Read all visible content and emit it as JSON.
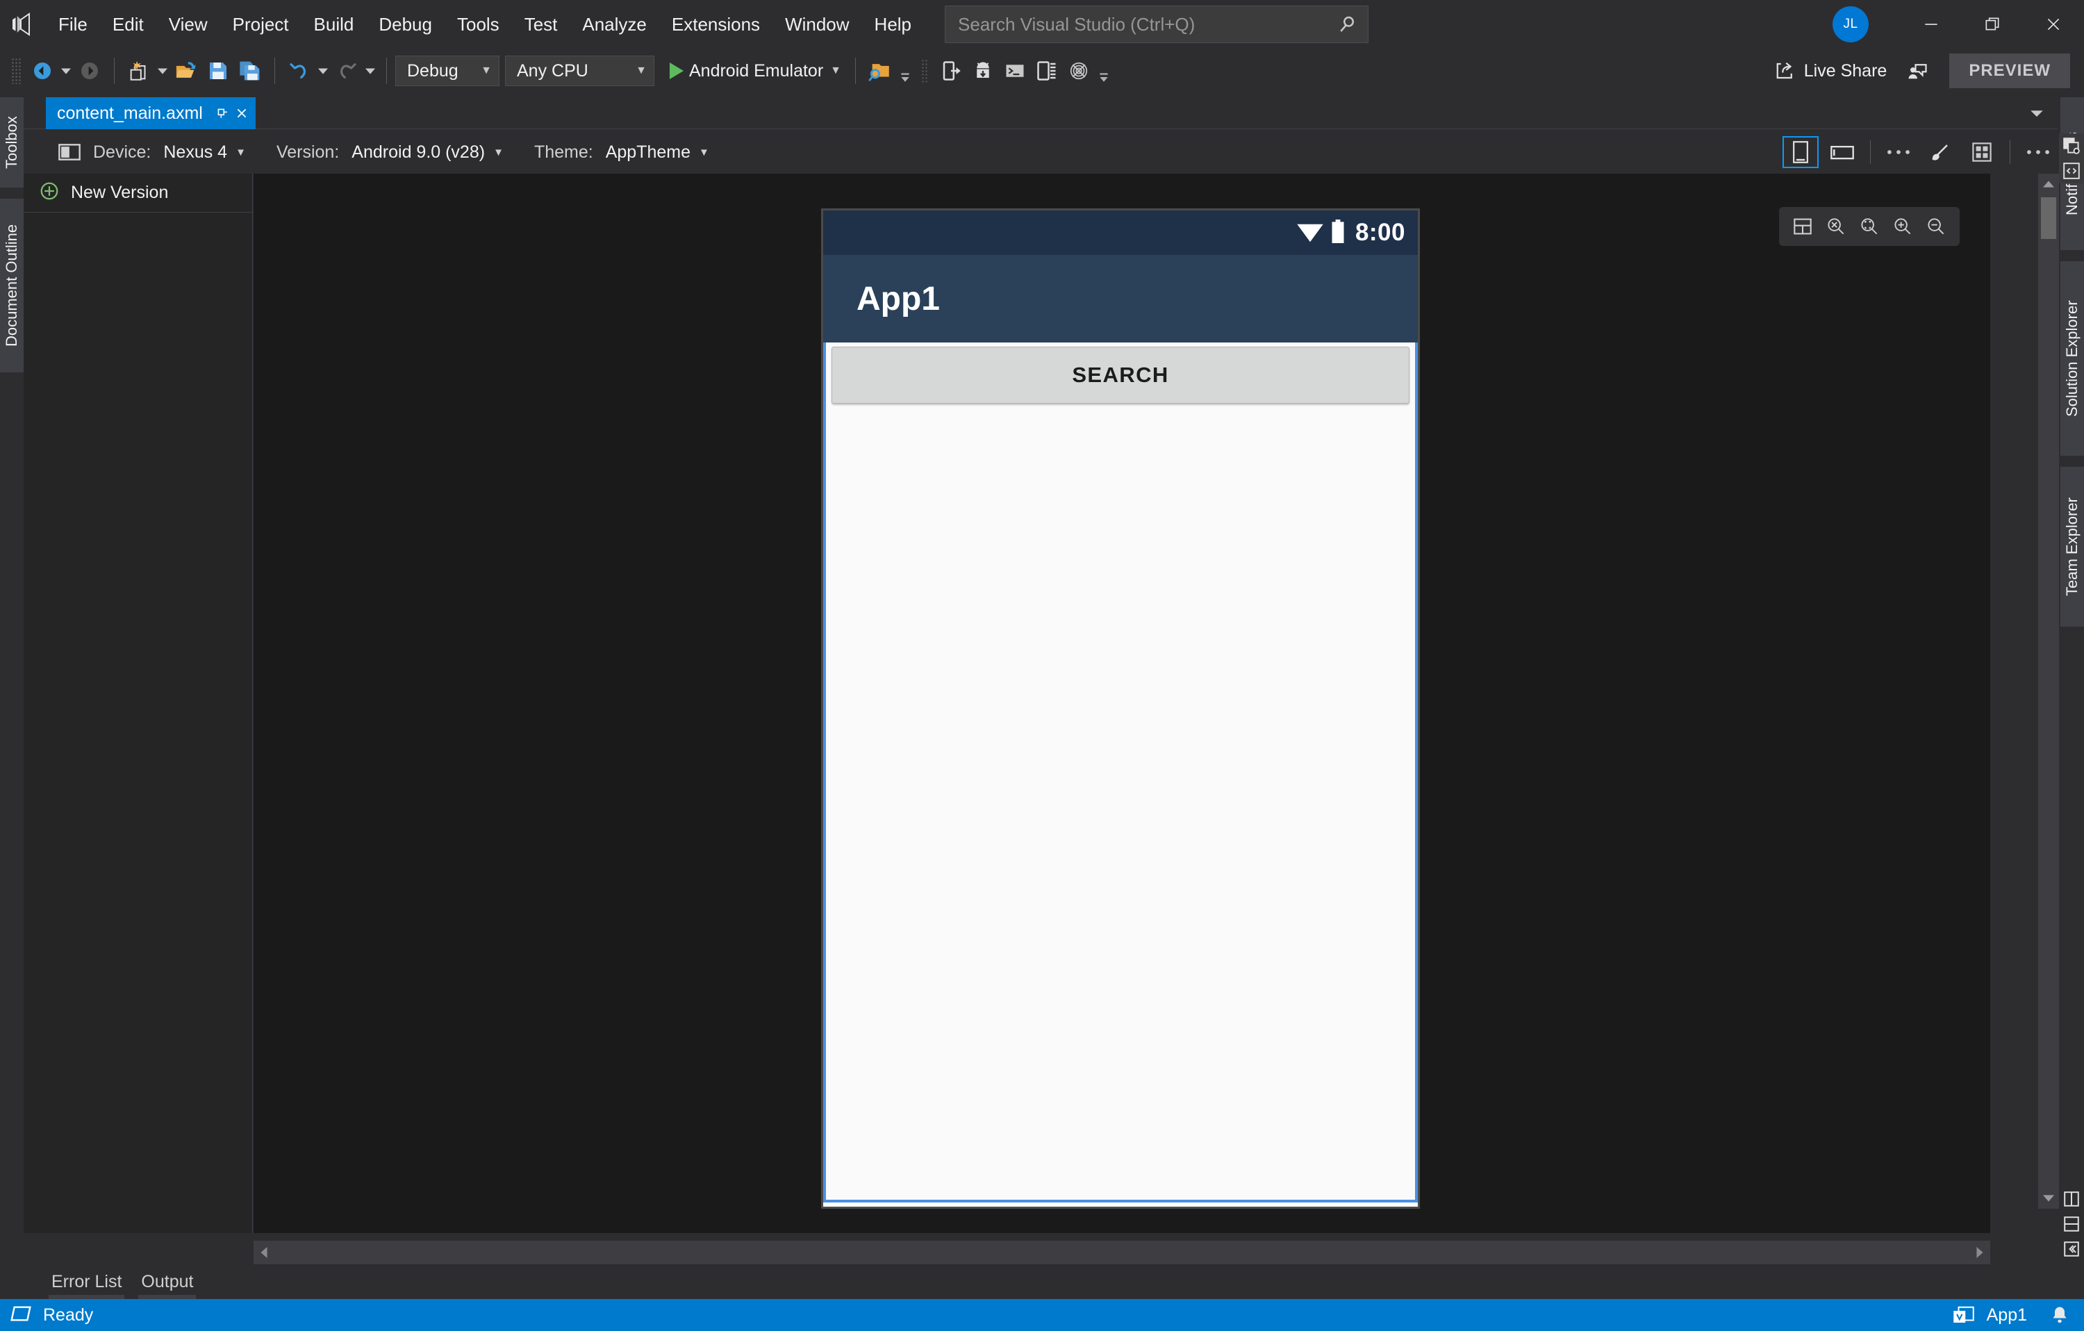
{
  "window": {
    "logo_icon": "visual-studio-logo",
    "menus": [
      "File",
      "Edit",
      "View",
      "Project",
      "Build",
      "Debug",
      "Tools",
      "Test",
      "Analyze",
      "Extensions",
      "Window",
      "Help"
    ],
    "search_placeholder": "Search Visual Studio (Ctrl+Q)",
    "search_value": "",
    "search_icon": "magnifier-icon",
    "avatar_initials": "JL",
    "minimize_icon": "minimize-icon",
    "restore_icon": "restore-icon",
    "close_icon": "close-icon"
  },
  "toolbar": {
    "nav_back_icon": "navigate-back-icon",
    "nav_forward_icon": "navigate-forward-icon",
    "new_item_icon": "new-item-icon",
    "open_file_icon": "open-file-icon",
    "save_icon": "save-icon",
    "save_all_icon": "save-all-icon",
    "undo_icon": "undo-icon",
    "redo_icon": "redo-icon",
    "configuration": "Debug",
    "platform": "Any CPU",
    "run_target": "Android Emulator",
    "run_icon": "play-icon",
    "find_in_files_icon": "find-in-files-icon",
    "device_deploy_icon": "device-deploy-icon",
    "android_sdk_manager_icon": "android-sdk-manager-icon",
    "adb_console_icon": "adb-console-icon",
    "device_log_icon": "device-log-icon",
    "android_device_monitor_icon": "android-device-monitor-icon",
    "live_share_label": "Live Share",
    "live_share_icon": "live-share-icon",
    "feedback_icon": "feedback-icon",
    "preview_badge": "PREVIEW"
  },
  "left_dock": {
    "tabs": [
      "Toolbox",
      "Document Outline"
    ]
  },
  "right_dock": {
    "tabs": [
      "Notifications",
      "Solution Explorer",
      "Team Explorer"
    ]
  },
  "document_tab": {
    "name": "content_main.axml",
    "pin_icon": "pin-icon",
    "close_icon": "close-icon",
    "tab_overflow_icon": "chevron-down-icon"
  },
  "designer_toolbar": {
    "device_icon": "device-preview-icon",
    "device_label": "Device:",
    "device_value": "Nexus 4",
    "version_label": "Version:",
    "version_value": "Android 9.0 (v28)",
    "theme_label": "Theme:",
    "theme_value": "AppTheme",
    "caret_icon": "chevron-down-icon",
    "portrait_icon": "portrait-orientation-icon",
    "landscape_icon": "landscape-orientation-icon",
    "more_options_icon": "ellipsis-icon",
    "brush_icon": "brush-icon",
    "grid_icon": "grid-icon",
    "more_options2_icon": "ellipsis-icon",
    "designer_surface_icon": "designer-surface-icon",
    "source_code_icon": "source-code-icon"
  },
  "left_panel": {
    "new_version_label": "New Version",
    "new_version_icon": "plus-circle-icon"
  },
  "designer": {
    "zoom_tools": {
      "fit_icon": "fit-to-window-icon",
      "reset_icon": "zoom-reset-icon",
      "actual_icon": "zoom-actual-size-icon",
      "zoom_in_icon": "zoom-in-icon",
      "zoom_out_icon": "zoom-out-icon"
    },
    "split_vertical_icon": "split-vertical-icon",
    "split_horizontal_icon": "split-horizontal-icon",
    "collapse_pane_icon": "collapse-pane-icon"
  },
  "phone_preview": {
    "status_time": "8:00",
    "wifi_icon": "wifi-icon",
    "battery_icon": "battery-icon",
    "app_title": "App1",
    "search_button_label": "SEARCH",
    "colors": {
      "status_bar": "#1f3049",
      "action_bar": "#2b4059",
      "selection_border": "#4a90e2",
      "button_face": "#d6d7d7",
      "content_bg": "#fafafa"
    }
  },
  "bottom_tabs": [
    "Error List",
    "Output"
  ],
  "status_bar": {
    "ready_text": "Ready",
    "ready_icon": "status-shape-icon",
    "project_name": "App1",
    "project_icon": "vs-window-icon",
    "notification_icon": "bell-icon",
    "accent_color": "#007acc"
  }
}
